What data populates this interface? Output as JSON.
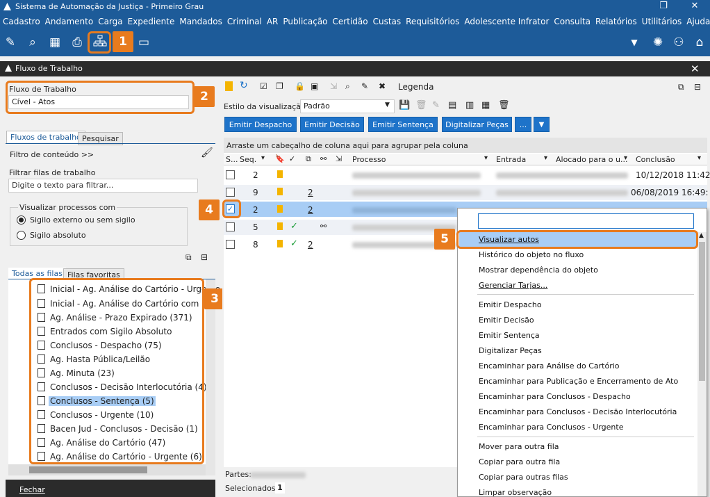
{
  "app": {
    "title": "Sistema de Automação da Justiça - Primeiro Grau"
  },
  "menu": [
    "Cadastro",
    "Andamento",
    "Carga",
    "Expediente",
    "Mandados",
    "Criminal",
    "AR",
    "Publicação",
    "Certidão",
    "Custas",
    "Requisitórios",
    "Adolescente Infrator",
    "Consulta",
    "Relatórios",
    "Utilitários",
    "Ajuda"
  ],
  "panel": {
    "title": "Fluxo de Trabalho"
  },
  "fluxo": {
    "label": "Fluxo de Trabalho",
    "value": "Cível - Atos"
  },
  "tabs": {
    "fluxos": "Fluxos de trabalho",
    "pesquisar": "Pesquisar"
  },
  "filtro": {
    "conteudo": "Filtro de conteúdo >>",
    "label": "Filtrar filas de trabalho",
    "placeholder": "Digite o texto para filtrar..."
  },
  "visualizar": {
    "legend": "Visualizar processos com",
    "opt1": "Sigilo externo ou sem sigilo",
    "opt2": "Sigilo absoluto"
  },
  "filatabs": {
    "todas": "Todas as filas",
    "favoritas": "Filas favoritas"
  },
  "filas": [
    "Inicial - Ag. Análise do Cartório - Urgente",
    "Inicial - Ag. Análise do Cartório com Emer",
    "Ag. Análise - Prazo Expirado (371)",
    "Entrados com Sigilo Absoluto",
    "Conclusos - Despacho (75)",
    "Ag. Hasta Pública/Leilão",
    "Ag. Minuta (23)",
    "Conclusos - Decisão Interlocutória (4)",
    "Conclusos - Sentença (5)",
    "Conclusos - Urgente (10)",
    "Bacen Jud - Conclusos - Decisão (1)",
    "Ag. Análise do Cartório (47)",
    "Ag. Análise do Cartório - Urgente (6)"
  ],
  "fechar": "Fechar",
  "rtoolbar": {
    "legenda": "Legenda",
    "estilo": "Estilo da visualização",
    "estilo_value": "Padrão"
  },
  "buttons": {
    "despacho": "Emitir Despacho",
    "decisao": "Emitir Decisão",
    "sentenca": "Emitir Sentença",
    "digitalizar": "Digitalizar Peças",
    "more": "..."
  },
  "grid": {
    "group_hint": "Arraste um cabeçalho de coluna aqui para agrupar pela coluna",
    "cols": {
      "s": "S...",
      "seq": "Seq.",
      "processo": "Processo",
      "entrada": "Entrada",
      "alocado": "Alocado para o u...",
      "conclusao": "Conclusão"
    },
    "rows": [
      {
        "seq": "2",
        "num": "",
        "conclusao": "10/12/2018 11:42:"
      },
      {
        "seq": "9",
        "num": "2",
        "conclusao": "06/08/2019 16:49:"
      },
      {
        "seq": "2",
        "num": "2",
        "conclusao": ""
      },
      {
        "seq": "5",
        "num": "",
        "conclusao": ""
      },
      {
        "seq": "8",
        "num": "2",
        "conclusao": ""
      }
    ]
  },
  "status": {
    "partes": "Partes:",
    "selecionados": "Selecionados",
    "count": "1"
  },
  "context_menu": [
    "Visualizar autos",
    "Histórico do objeto no fluxo",
    "Mostrar dependência do objeto",
    "Gerenciar Tarjas...",
    "Emitir Despacho",
    "Emitir Decisão",
    "Emitir Sentença",
    "Digitalizar Peças",
    "Encaminhar para Análise do Cartório",
    "Encaminhar para Publicação e Encerramento de Ato",
    "Encaminhar para Conclusos - Despacho",
    "Encaminhar para Conclusos - Decisão Interlocutória",
    "Encaminhar para Conclusos - Urgente",
    "Mover para outra fila",
    "Copiar para outra fila",
    "Copiar para outras filas",
    "Limpar observação"
  ],
  "badges": [
    "1",
    "2",
    "3",
    "4",
    "5"
  ],
  "colors": {
    "brand": "#1d5b99",
    "button": "#1e73c9",
    "highlight": "#e87b1e",
    "selection": "#a8cdf5"
  }
}
